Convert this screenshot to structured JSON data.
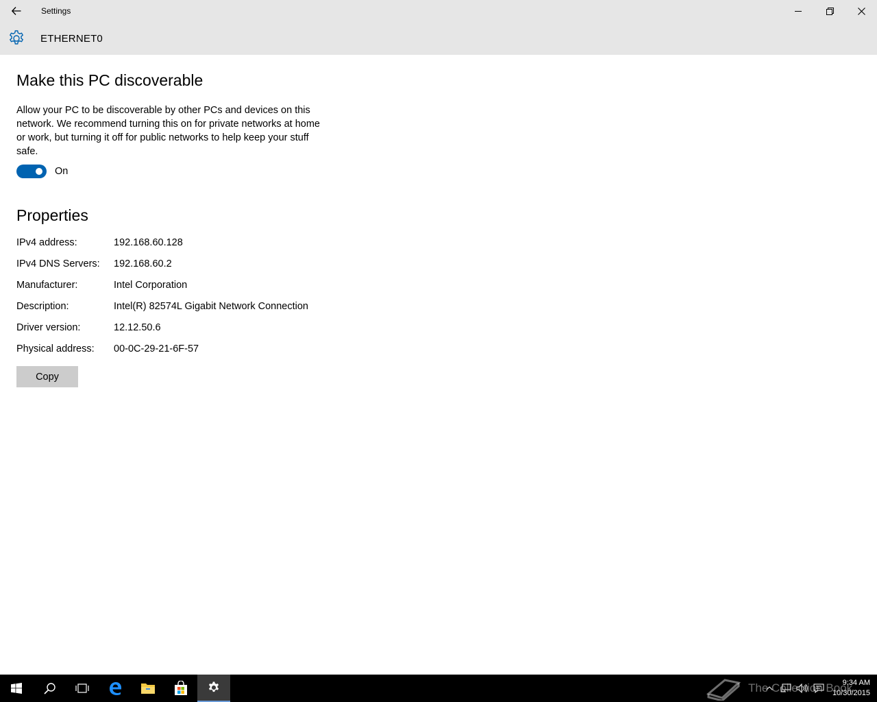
{
  "window": {
    "title": "Settings"
  },
  "header": {
    "page_name": "ETHERNET0"
  },
  "discoverable": {
    "title": "Make this PC discoverable",
    "description": "Allow your PC to be discoverable by other PCs and devices on this network. We recommend turning this on for private networks at home or work, but turning it off for public networks to help keep your stuff safe.",
    "toggle_state": "On"
  },
  "properties": {
    "title": "Properties",
    "rows": [
      {
        "key": "IPv4 address:",
        "value": "192.168.60.128"
      },
      {
        "key": "IPv4 DNS Servers:",
        "value": "192.168.60.2"
      },
      {
        "key": "Manufacturer:",
        "value": "Intel Corporation"
      },
      {
        "key": "Description:",
        "value": "Intel(R) 82574L Gigabit Network Connection"
      },
      {
        "key": "Driver version:",
        "value": "12.12.50.6"
      },
      {
        "key": "Physical address:",
        "value": "00-0C-29-21-6F-57"
      }
    ],
    "copy_label": "Copy"
  },
  "taskbar": {
    "items": [
      "start-icon",
      "search-icon",
      "task-view-icon",
      "edge-icon",
      "file-explorer-icon",
      "store-icon",
      "settings-icon"
    ],
    "clock_time": "9:34 AM",
    "clock_date": "10/30/2015",
    "watermark": "The Collection Book"
  },
  "colors": {
    "accent": "#0063b1",
    "chrome": "#e6e6e6",
    "taskbar": "#000000"
  }
}
